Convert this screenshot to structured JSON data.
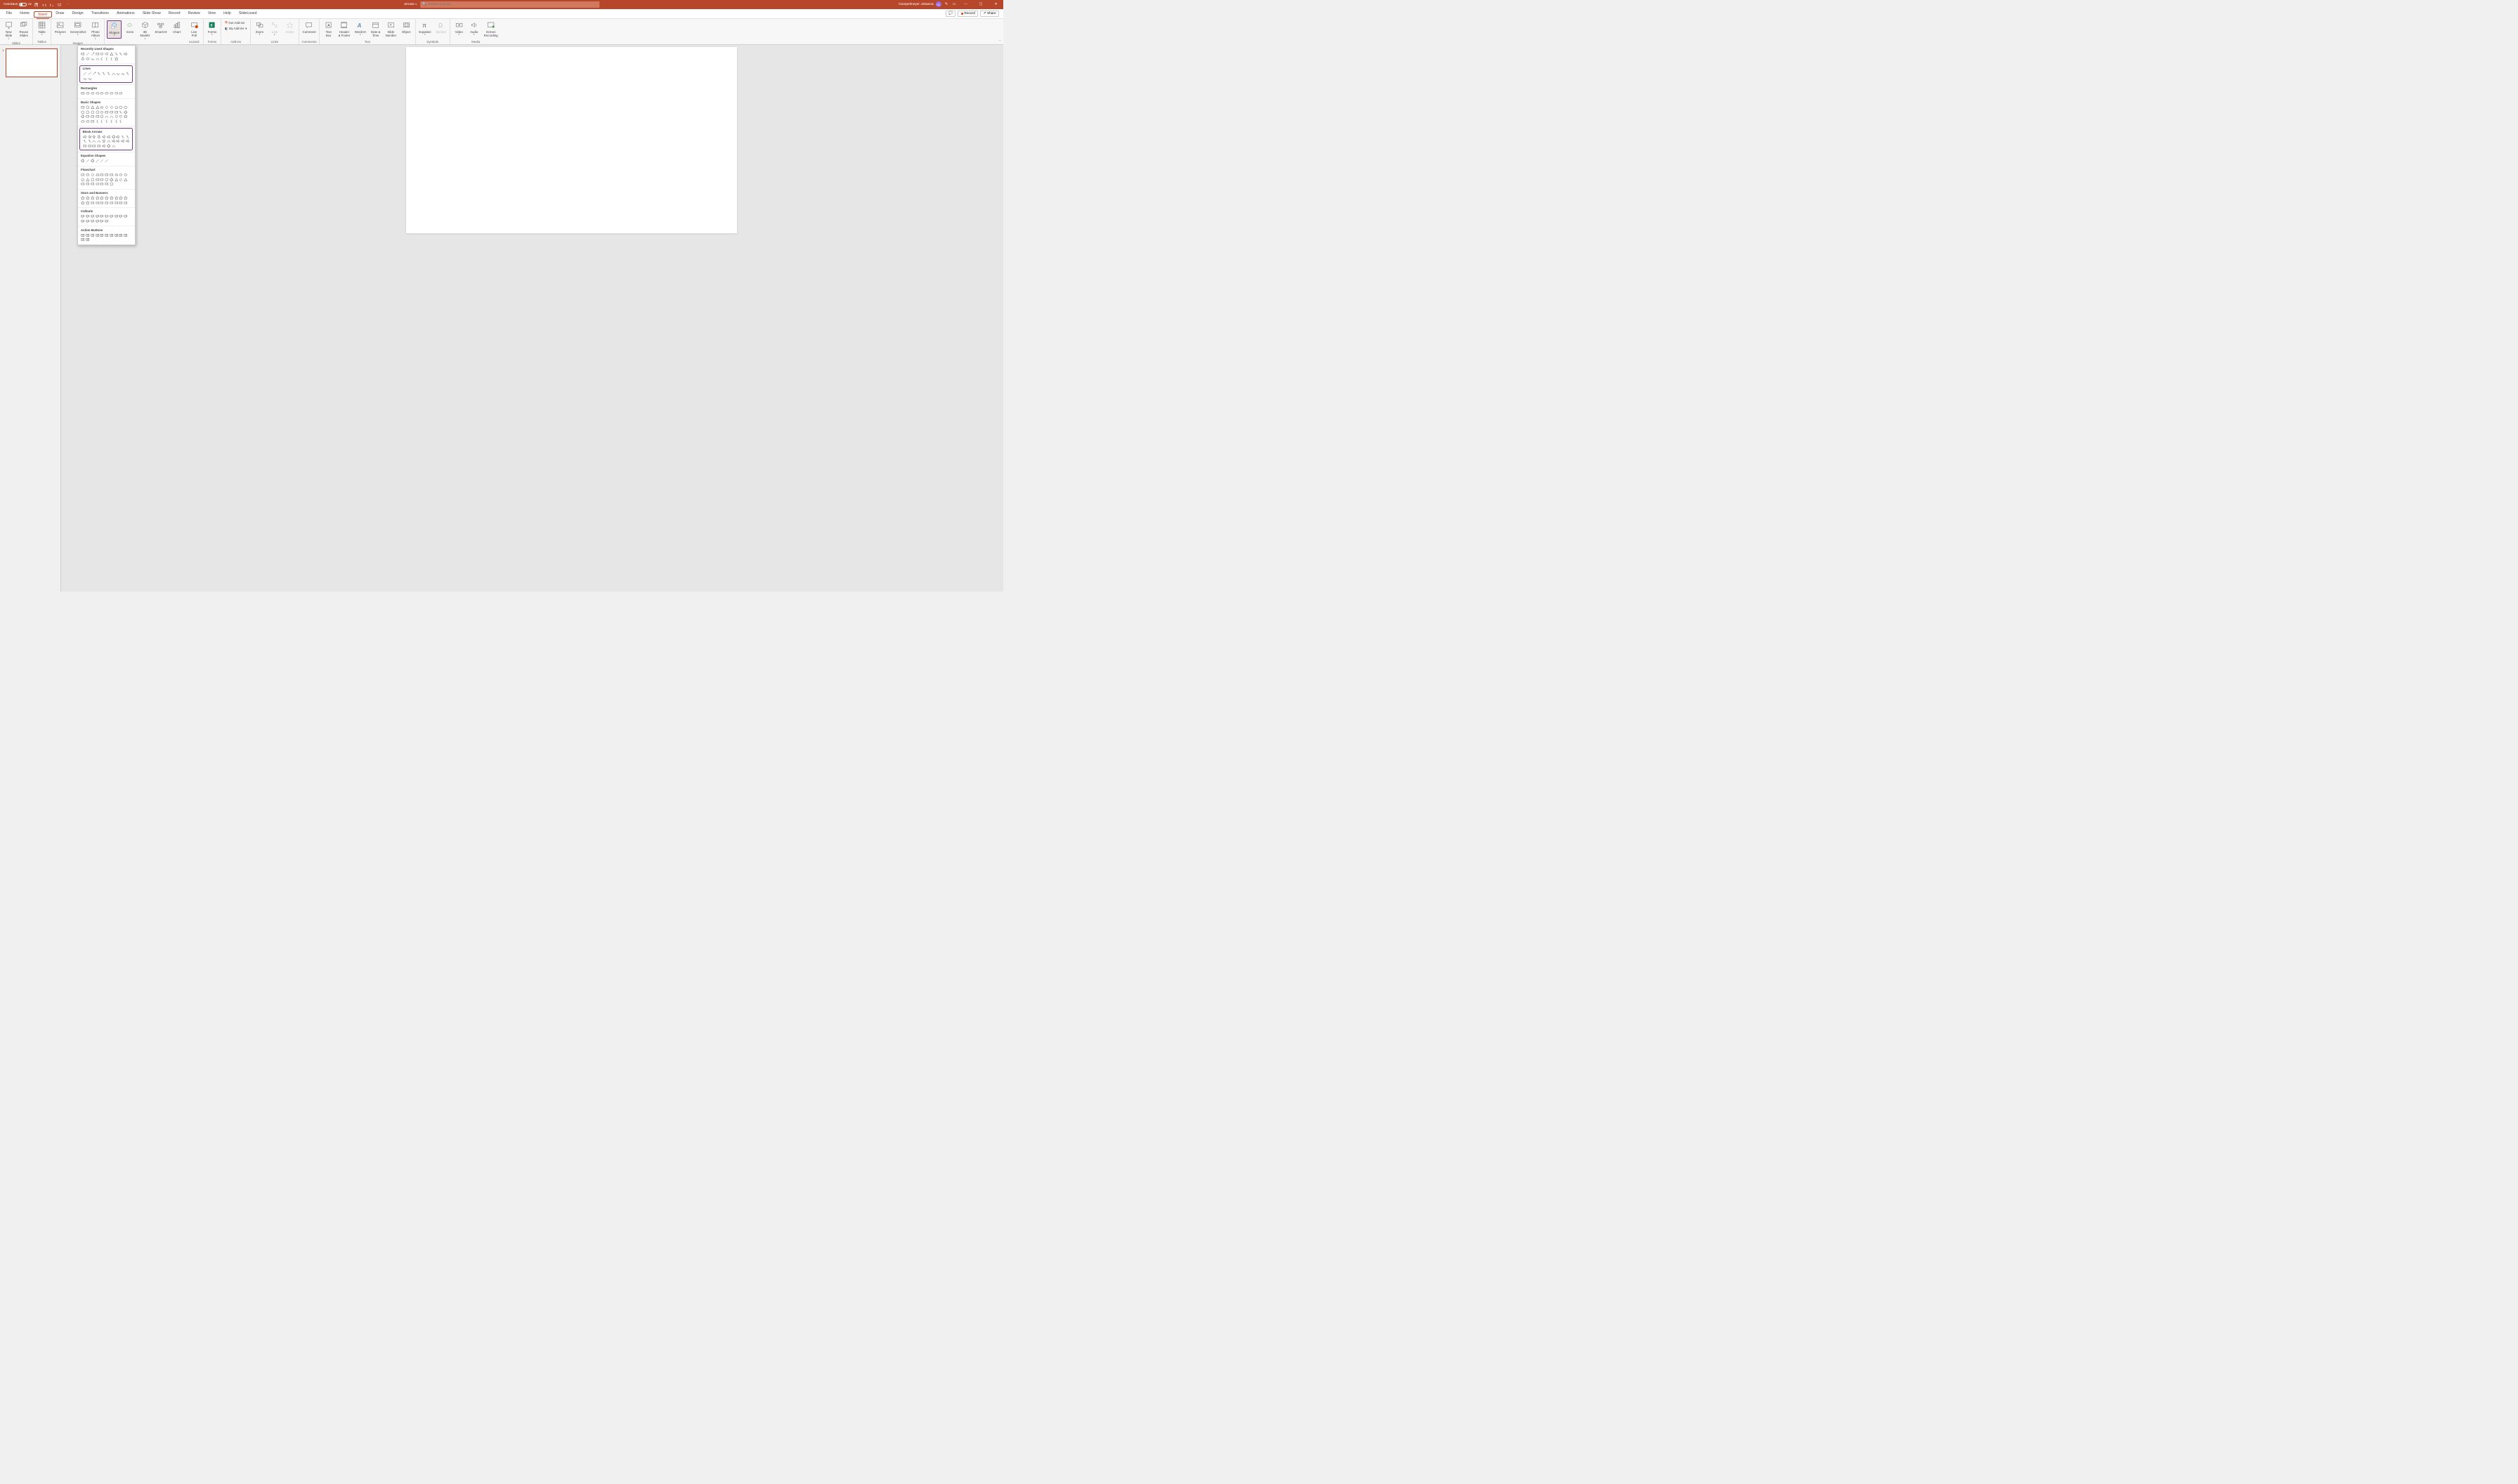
{
  "titlebar": {
    "autosave_label": "AutoSave",
    "autosave_state": "Off",
    "filename": "arrows",
    "search_placeholder": "Search (Alt+Q)",
    "user_name": "Gumpelmeyer Johanna",
    "user_initials": "GJ"
  },
  "tabs": {
    "file": "File",
    "home": "Home",
    "insert": "Insert",
    "draw": "Draw",
    "design": "Design",
    "transitions": "Transitions",
    "animations": "Animations",
    "slideshow": "Slide Show",
    "record": "Record",
    "review": "Review",
    "view": "View",
    "help": "Help",
    "slidelizard": "SlideLizard"
  },
  "ribbon_right": {
    "comments": "",
    "record": "Record",
    "share": "Share"
  },
  "groups": {
    "slides": {
      "label": "Slides",
      "new_slide": "New\nSlide",
      "reuse_slides": "Reuse\nSlides"
    },
    "tables": {
      "label": "Tables",
      "table": "Table"
    },
    "images": {
      "label": "Images",
      "pictures": "Pictures",
      "screenshot": "Screenshot",
      "photo_album": "Photo\nAlbum"
    },
    "illustrations": {
      "shapes": "Shapes",
      "icons": "Icons",
      "models": "3D\nModels",
      "smartart": "SmartArt",
      "chart": "Chart"
    },
    "slidelizard": {
      "label": "eLizard",
      "live_poll": "Live\nPoll"
    },
    "forms": {
      "label": "Forms",
      "forms": "Forms"
    },
    "addins": {
      "label": "Add-ins",
      "get": "Get Add-ins",
      "my": "My Add-ins"
    },
    "links": {
      "label": "Links",
      "zoom": "Zoom",
      "link": "Link",
      "action": "Action"
    },
    "comments": {
      "label": "Comments",
      "comment": "Comment"
    },
    "text": {
      "label": "Text",
      "textbox": "Text\nBox",
      "header": "Header\n& Footer",
      "wordart": "WordArt",
      "datetime": "Date &\nTime",
      "slidenum": "Slide\nNumber",
      "object": "Object"
    },
    "symbols": {
      "label": "Symbols",
      "equation": "Equation",
      "symbol": "Symbol"
    },
    "media": {
      "label": "Media",
      "video": "Video",
      "audio": "Audio",
      "screen": "Screen\nRecording"
    }
  },
  "slidepanel": {
    "slide1_num": "1"
  },
  "shapes_dropdown": {
    "recently_used": "Recently Used Shapes",
    "lines": "Lines",
    "rectangles": "Rectangles",
    "basic_shapes": "Basic Shapes",
    "block_arrows": "Block Arrows",
    "equation_shapes": "Equation Shapes",
    "flowchart": "Flowchart",
    "stars_banners": "Stars and Banners",
    "callouts": "Callouts",
    "action_buttons": "Action Buttons"
  }
}
